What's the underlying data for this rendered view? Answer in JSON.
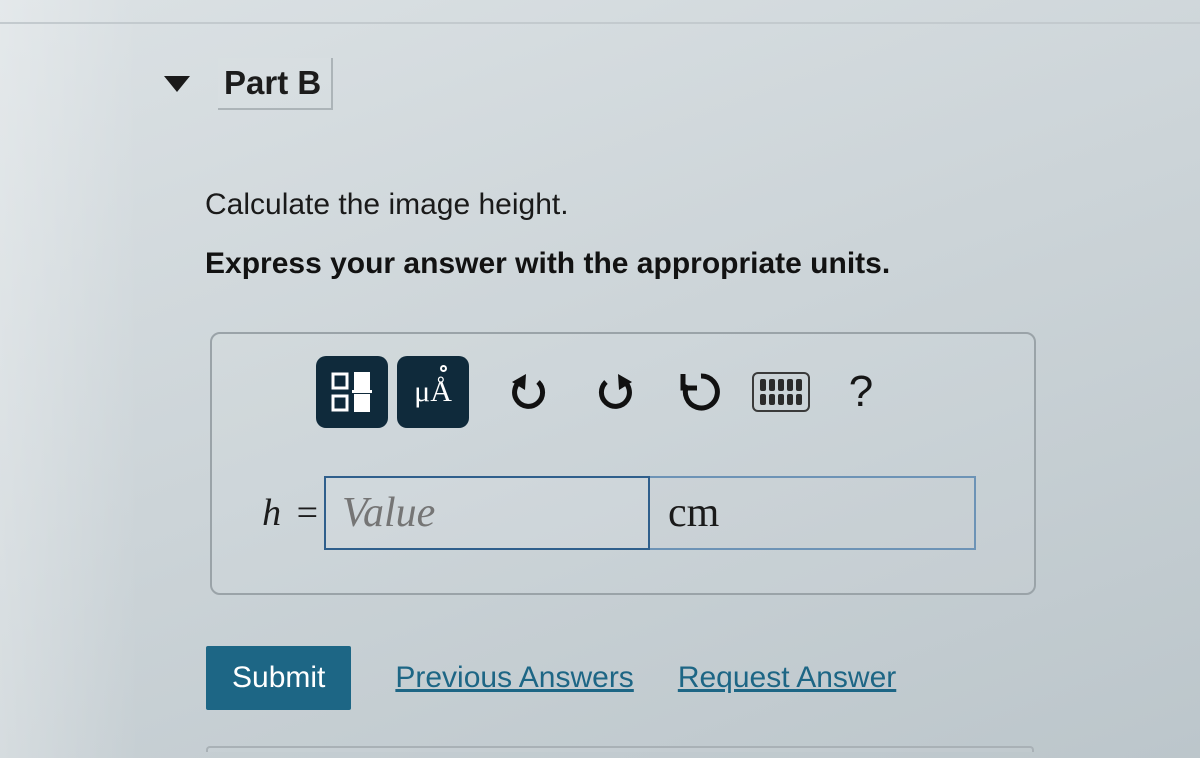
{
  "part": {
    "label": "Part B"
  },
  "question": {
    "prompt": "Calculate the image height.",
    "instruction": "Express your answer with the appropriate units."
  },
  "toolbar": {
    "templates_icon": "templates-icon",
    "units_label": "μÅ",
    "undo_icon": "undo-icon",
    "redo_icon": "redo-icon",
    "reset_icon": "reset-icon",
    "keyboard_icon": "keyboard-icon",
    "help_label": "?"
  },
  "answer": {
    "variable": "h",
    "equals": "=",
    "value_placeholder": "Value",
    "value": "",
    "unit": "cm"
  },
  "actions": {
    "submit": "Submit",
    "previous": "Previous Answers",
    "request": "Request Answer"
  }
}
